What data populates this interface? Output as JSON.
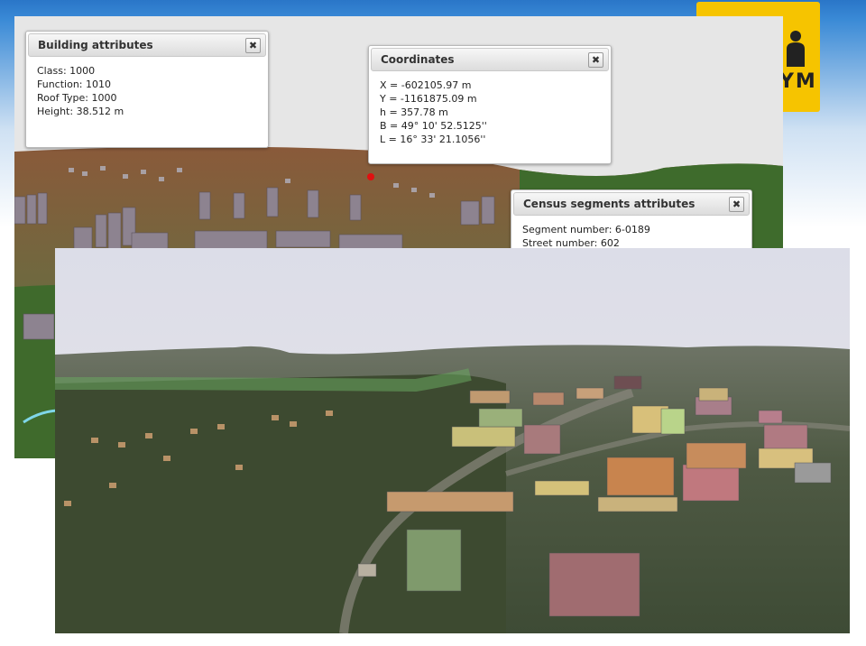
{
  "logo": {
    "text": "YM"
  },
  "building_panel": {
    "title": "Building attributes",
    "rows": [
      "Class: 1000",
      "Function: 1010",
      "Roof Type: 1000",
      "Height: 38.512 m"
    ],
    "close_label": "✖"
  },
  "coordinates_panel": {
    "title": "Coordinates",
    "rows": [
      "X = -602105.97 m",
      "Y = -1161875.09 m",
      "h = 357.78 m",
      "B = 49° 10' 52.5125''",
      "L = 16° 33' 21.1056''"
    ],
    "close_label": "✖"
  },
  "census_panel": {
    "title": "Census segments attributes",
    "rows": [
      "Segment number: 6-0189",
      "Street number: 602"
    ],
    "close_label": "✖"
  },
  "colors": {
    "brand_yellow": "#f6c400",
    "brand_blue": "#2a76c8"
  }
}
